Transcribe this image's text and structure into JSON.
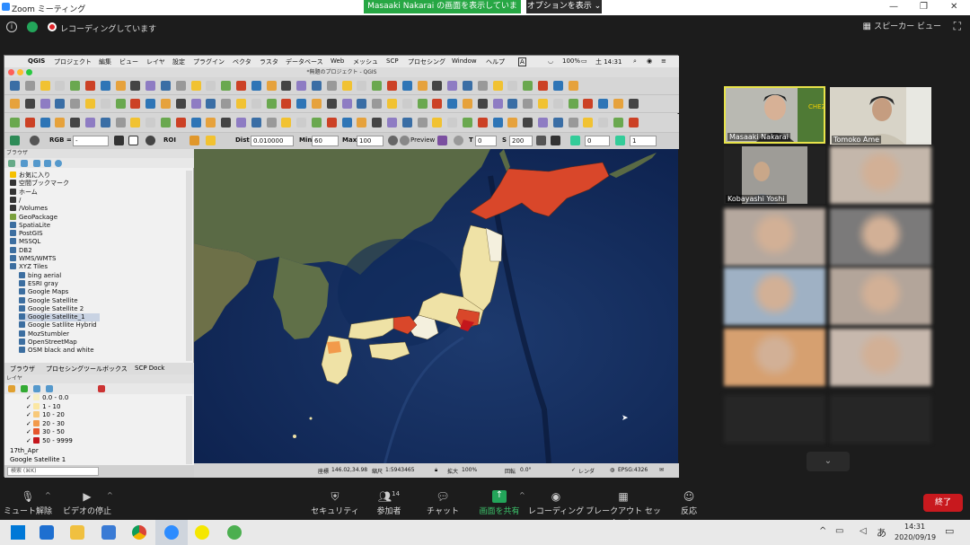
{
  "zoom": {
    "window_title": "Zoom ミーティング",
    "share_banner": "Masaaki Nakarai の画面を表示しています",
    "options_button": "オプションを表示 ⌄",
    "recording_text": "レコーディングしています",
    "speaker_view": "スピーカー ビュー",
    "participants": [
      {
        "name": "Masaaki Nakarai"
      },
      {
        "name": "Tomoko Ame"
      },
      {
        "name": "Kobayashi Yoshi"
      }
    ],
    "controls": [
      {
        "label": "ミュート解除",
        "icon": "mic-muted-icon"
      },
      {
        "label": "ビデオの停止",
        "icon": "video-icon"
      },
      {
        "label": "セキュリティ",
        "icon": "shield-icon"
      },
      {
        "label": "参加者",
        "icon": "participants-icon",
        "count": "14"
      },
      {
        "label": "チャット",
        "icon": "chat-icon"
      },
      {
        "label": "画面を共有",
        "icon": "share-screen-icon"
      },
      {
        "label": "レコーディング",
        "icon": "record-icon"
      },
      {
        "label": "ブレークアウト セッション",
        "icon": "breakout-icon"
      },
      {
        "label": "反応",
        "icon": "reaction-icon"
      }
    ],
    "end_button": "終了"
  },
  "mac_menu": [
    "QGIS",
    "プロジェクト",
    "編集",
    "ビュー",
    "レイヤ",
    "設定",
    "プラグイン",
    "ベクタ",
    "ラスタ",
    "データベース",
    "Web",
    "メッシュ",
    "SCP",
    "プロセシング",
    "Window",
    "ヘルプ"
  ],
  "mac_status": {
    "battery": "100%",
    "time": "土 14:31"
  },
  "qgis": {
    "title": "*無題のプロジェクト - QGIS",
    "scp_toolbar": {
      "rgb_label": "RGB =",
      "rgb_value": "-",
      "roi_label": "ROI",
      "dist_label": "Dist",
      "dist_value": "0.010000",
      "min_label": "Min",
      "min_value": "60",
      "max_label": "Max",
      "max_value": "100",
      "preview_label": "Preview",
      "t_label": "T",
      "t_value": "0",
      "s_label": "S",
      "s_value": "200",
      "v1": "0",
      "v2": "1"
    },
    "browser_title": "ブラウザ",
    "browser_items": [
      {
        "label": "お気に入り",
        "color": "#f5c000"
      },
      {
        "label": "空間ブックマーク",
        "color": "#333"
      },
      {
        "label": "ホーム",
        "color": "#333"
      },
      {
        "label": "/",
        "color": "#333"
      },
      {
        "label": "/Volumes",
        "color": "#333"
      },
      {
        "label": "GeoPackage",
        "color": "#7aa03c"
      },
      {
        "label": "SpatiaLite",
        "color": "#3c6ea0"
      },
      {
        "label": "PostGIS",
        "color": "#3c6ea0"
      },
      {
        "label": "MSSQL",
        "color": "#3c6ea0"
      },
      {
        "label": "DB2",
        "color": "#3c6ea0"
      },
      {
        "label": "WMS/WMTS",
        "color": "#3c6ea0"
      },
      {
        "label": "XYZ Tiles",
        "color": "#3c6ea0"
      },
      {
        "label": "bing aerial",
        "color": "#3c6ea0"
      },
      {
        "label": "ESRI gray",
        "color": "#3c6ea0"
      },
      {
        "label": "Google Maps",
        "color": "#3c6ea0"
      },
      {
        "label": "Google Satellite",
        "color": "#3c6ea0"
      },
      {
        "label": "Google Satellite 2",
        "color": "#3c6ea0"
      },
      {
        "label": "Google Satellite_1",
        "color": "#3c6ea0"
      },
      {
        "label": "Google Satllite Hybrid",
        "color": "#3c6ea0"
      },
      {
        "label": "MozStumbler",
        "color": "#3c6ea0"
      },
      {
        "label": "OpenStreetMap",
        "color": "#3c6ea0"
      },
      {
        "label": "OSM black and white",
        "color": "#3c6ea0"
      }
    ],
    "tabs": [
      "ブラウザ",
      "プロセシングツールボックス",
      "SCP Dock"
    ],
    "layer_title": "レイヤ",
    "layer_legend": [
      {
        "label": "0.0 - 0.0",
        "color": "#f6efc4"
      },
      {
        "label": "1 - 10",
        "color": "#fbe7a3"
      },
      {
        "label": "10 - 20",
        "color": "#f8c97a"
      },
      {
        "label": "20 - 30",
        "color": "#f29a4b"
      },
      {
        "label": "30 - 50",
        "color": "#e5552c"
      },
      {
        "label": "50 - 9999",
        "color": "#c4161c"
      }
    ],
    "layer_items": [
      "17th_Apr",
      "Google Satellite 1"
    ],
    "search_placeholder": "検索 (⌘K)",
    "status": {
      "coord_label": "座標",
      "coord": "146.02,34.98",
      "scale_label": "縮尺",
      "scale": "1:5943465",
      "zoom_label": "拡大",
      "zoom": "100%",
      "rot_label": "回転",
      "rot": "0.0°",
      "render_label": "レンダ",
      "crs": "EPSG:4326"
    }
  },
  "taskbar": {
    "time": "14:31",
    "date": "2020/09/19",
    "ime": "あ"
  }
}
